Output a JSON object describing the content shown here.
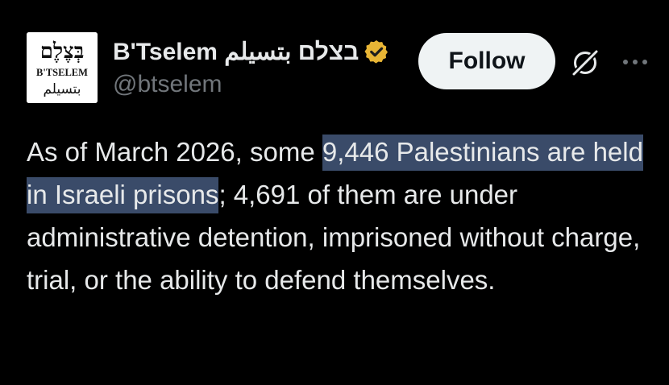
{
  "author": {
    "display_name": "B'Tselem בצלם بتسيلم",
    "handle": "@btselem",
    "avatar": {
      "hebrew": "בְּצֶלֶם",
      "latin": "B'TSELEM",
      "arabic": "بتسيلم"
    },
    "verified": true,
    "verified_icon": "verified-badge-icon",
    "verified_color": "#e8b535"
  },
  "actions": {
    "follow_label": "Follow",
    "grok_icon": "grok-icon",
    "more_icon": "more-icon"
  },
  "tweet": {
    "text_before": "As of March 2026, some ",
    "text_highlighted": "9,446 Palestinians are held in Israeli prisons",
    "text_after": "; 4,691 of them are under administrative detention, imprisoned without charge, trial, or the ability to defend themselves."
  },
  "colors": {
    "background": "#000000",
    "text": "#e7e9ea",
    "secondary_text": "#71767b",
    "follow_bg": "#eff3f4",
    "selection": "#3a4b69"
  }
}
